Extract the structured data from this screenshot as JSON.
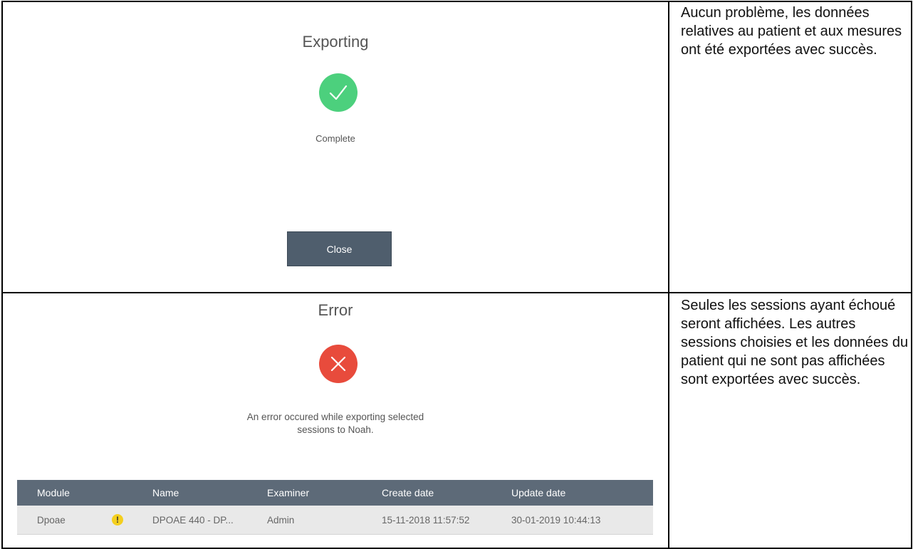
{
  "export_success": {
    "title": "Exporting",
    "status": "Complete",
    "close_label": "Close",
    "icon": "check-circle-icon",
    "description": "Aucun problème, les données relatives au patient et aux mesures ont été exportées avec succès."
  },
  "export_error": {
    "title": "Error",
    "icon": "error-circle-icon",
    "message_line1": "An error occured while exporting selected",
    "message_line2": "sessions to Noah.",
    "description": "Seules les sessions ayant échoué seront affichées. Les autres sessions choisies et les données du patient qui ne sont pas affichées sont exportées avec succès.",
    "table": {
      "columns": [
        "Module",
        "Name",
        "Examiner",
        "Create date",
        "Update date"
      ],
      "rows": [
        {
          "module": "Dpoae",
          "warning_icon": "warning-icon",
          "name": "DPOAE 440 - DP...",
          "examiner": "Admin",
          "create_date": "15-11-2018 11:57:52",
          "update_date": "30-01-2019 10:44:13"
        }
      ]
    }
  },
  "colors": {
    "success": "#4cd07d",
    "error": "#e84b3c",
    "button": "#4f5e6d",
    "table_header": "#5d6a78",
    "warning": "#f4cf1e"
  }
}
